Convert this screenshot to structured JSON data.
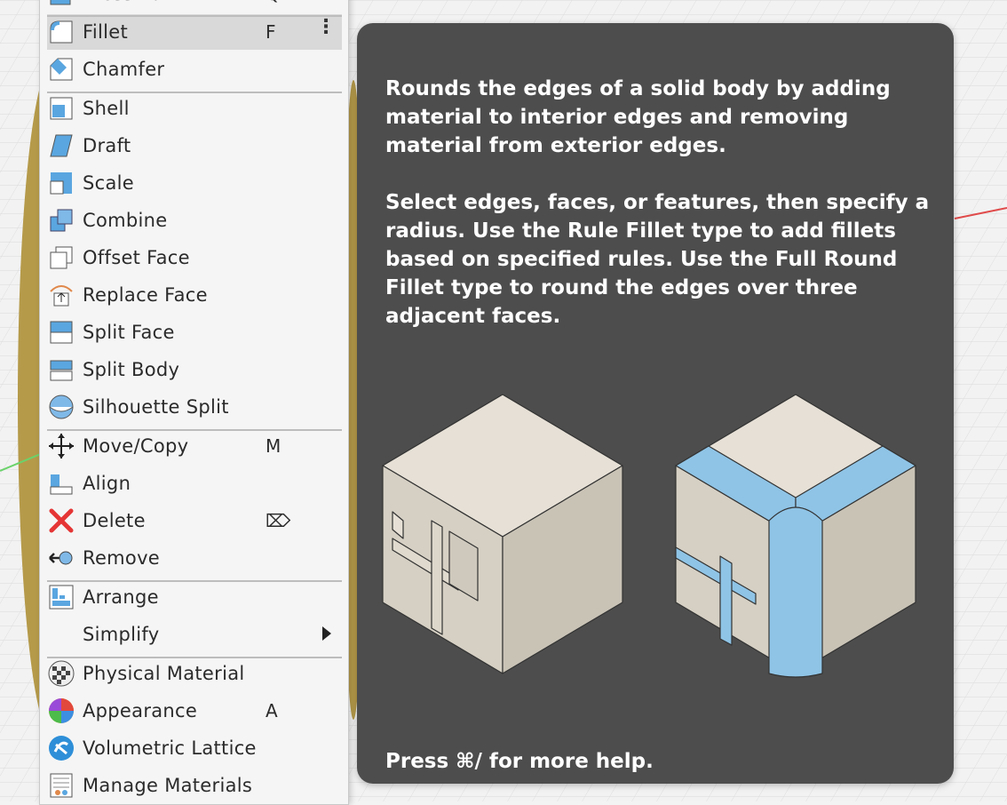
{
  "menu": {
    "items": [
      {
        "label": "Press Pull",
        "shortcut": "Q",
        "icon": "press-pull-icon"
      },
      {
        "label": "Fillet",
        "shortcut": "F",
        "icon": "fillet-icon",
        "active": true
      },
      {
        "label": "Chamfer",
        "icon": "chamfer-icon"
      },
      {
        "label": "Shell",
        "icon": "shell-icon"
      },
      {
        "label": "Draft",
        "icon": "draft-icon"
      },
      {
        "label": "Scale",
        "icon": "scale-icon"
      },
      {
        "label": "Combine",
        "icon": "combine-icon"
      },
      {
        "label": "Offset Face",
        "icon": "offset-face-icon"
      },
      {
        "label": "Replace Face",
        "icon": "replace-face-icon"
      },
      {
        "label": "Split Face",
        "icon": "split-face-icon"
      },
      {
        "label": "Split Body",
        "icon": "split-body-icon"
      },
      {
        "label": "Silhouette Split",
        "icon": "silhouette-split-icon"
      },
      {
        "label": "Move/Copy",
        "shortcut": "M",
        "icon": "move-icon"
      },
      {
        "label": "Align",
        "icon": "align-icon"
      },
      {
        "label": "Delete",
        "shortcut": "⌦",
        "icon": "delete-icon"
      },
      {
        "label": "Remove",
        "icon": "remove-icon"
      },
      {
        "label": "Arrange",
        "icon": "arrange-icon"
      },
      {
        "label": "Simplify",
        "icon": "",
        "submenu": true
      },
      {
        "label": "Physical Material",
        "icon": "physical-material-icon"
      },
      {
        "label": "Appearance",
        "shortcut": "A",
        "icon": "appearance-icon"
      },
      {
        "label": "Volumetric Lattice",
        "icon": "volumetric-lattice-icon"
      },
      {
        "label": "Manage Materials",
        "icon": "manage-materials-icon"
      }
    ]
  },
  "tooltip": {
    "paragraph1": "Rounds the edges of a solid body by adding material to interior edges and removing material from exterior edges.",
    "paragraph2": "Select edges, faces, or features, then specify a radius. Use the Rule Fillet type to add fillets based on specified rules. Use the Full Round Fillet type to round the edges over three adjacent faces.",
    "footer": "Press ⌘/ for more help."
  },
  "colors": {
    "menu_bg": "#f5f5f5",
    "highlight": "#d9d9d9",
    "tooltip_bg": "#4d4d4d",
    "icon_blue": "#5aa6e0",
    "fillet_blue": "#8fc4e6",
    "cube_face": "#e3ddd2"
  }
}
